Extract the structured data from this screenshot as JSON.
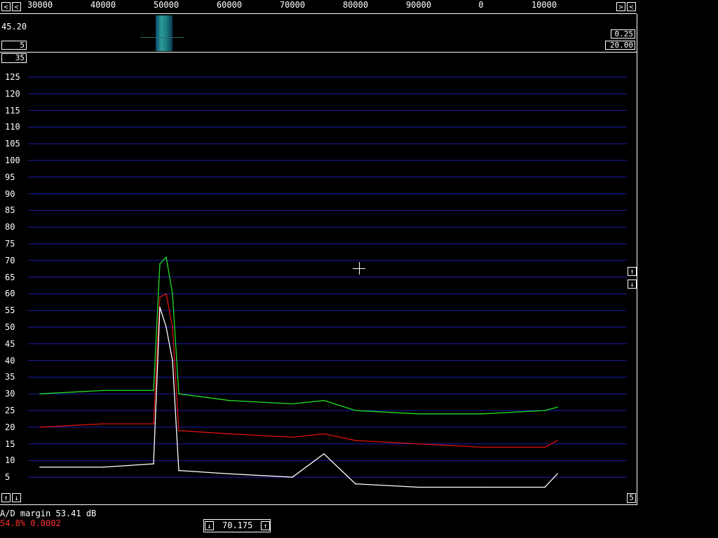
{
  "freq_scale": {
    "labels": [
      "30000",
      "40000",
      "50000",
      "60000",
      "70000",
      "80000",
      "90000",
      "0",
      "10000"
    ]
  },
  "waterfall": {
    "left_value": "45.20",
    "left_box": "5",
    "right_box_top": "0.25",
    "right_box_bottom": "20.00"
  },
  "spectrum": {
    "top_box": "35",
    "y_ticks": [
      "125",
      "120",
      "115",
      "110",
      "105",
      "100",
      "95",
      "90",
      "85",
      "80",
      "75",
      "70",
      "65",
      "60",
      "55",
      "50",
      "45",
      "40",
      "35",
      "30",
      "25",
      "20",
      "15",
      "10",
      "5"
    ],
    "right_box_bottom": "5"
  },
  "status": {
    "ad_margin": "A/D margin 53.41 dB",
    "percent": "54.8% 0.0002",
    "center_value": "70.175"
  },
  "colors": {
    "grid": "#1c1caa",
    "green_trace": "#22dd22",
    "red_trace": "#dd1111",
    "white_trace": "#ffffff",
    "status_red": "#ff3030"
  },
  "chart_data": {
    "type": "line",
    "xlabel": "",
    "ylabel": "",
    "ylim": [
      0,
      125
    ],
    "x": [
      30000,
      40000,
      48000,
      49000,
      50000,
      51000,
      52000,
      60000,
      70000,
      75000,
      80000,
      90000,
      0,
      10000,
      12000
    ],
    "series": [
      {
        "values": [
          30,
          31,
          31,
          69,
          71,
          60,
          30,
          28,
          27,
          28,
          25,
          24,
          24,
          25,
          26
        ]
      },
      {
        "values": [
          20,
          21,
          21,
          59,
          60,
          50,
          19,
          18,
          17,
          18,
          16,
          15,
          14,
          14,
          16
        ]
      },
      {
        "values": [
          8,
          8,
          9,
          56,
          50,
          40,
          7,
          6,
          5,
          12,
          3,
          2,
          2,
          2,
          6
        ]
      }
    ]
  }
}
